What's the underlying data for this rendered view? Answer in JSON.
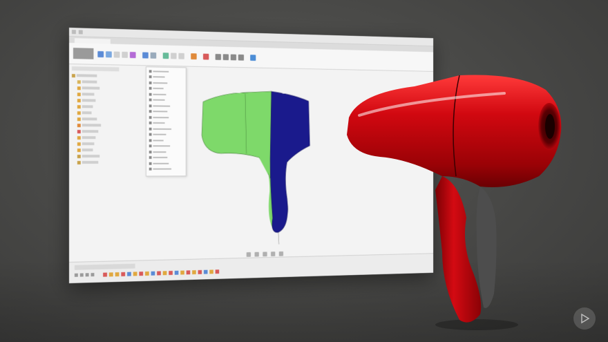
{
  "scene": {
    "description_colors": {
      "background": "#4a4a48",
      "render_red": "#c8020c",
      "render_grip": "#4d4d4d",
      "model_green": "#7ed96a",
      "model_blue": "#1a1a8c"
    }
  },
  "app": {
    "title": "",
    "tab_label": "",
    "workspace_label": "",
    "toolbar_groups": [
      {
        "name": "create",
        "icon_colors": [
          "#5b8bd6",
          "#7aa8e0",
          "#d0d0d0",
          "#d0d0d0",
          "#b46bd6"
        ]
      },
      {
        "name": "modify",
        "icon_colors": [
          "#5b8bd6",
          "#9ab"
        ]
      },
      {
        "name": "assemble",
        "icon_colors": [
          "#6b9",
          "#d0d0d0",
          "#d0d0d0"
        ]
      },
      {
        "name": "construct",
        "icon_colors": [
          "#e08a3a"
        ]
      },
      {
        "name": "inspect",
        "icon_colors": [
          "#d85a5a"
        ]
      },
      {
        "name": "insert",
        "icon_colors": [
          "#8a8a8a",
          "#8a8a8a",
          "#8a8a8a",
          "#8a8a8a"
        ]
      },
      {
        "name": "select",
        "icon_colors": [
          "#4c8dd6"
        ]
      }
    ],
    "browser_rows": [
      {
        "swatch": "#c9a24a",
        "width": 30
      },
      {
        "swatch": "#d9b45a",
        "width": 22
      },
      {
        "swatch": "#e0a840",
        "width": 26
      },
      {
        "swatch": "#e0a840",
        "width": 18
      },
      {
        "swatch": "#e0a840",
        "width": 20
      },
      {
        "swatch": "#e0a840",
        "width": 16
      },
      {
        "swatch": "#e0a840",
        "width": 14
      },
      {
        "swatch": "#e0a840",
        "width": 22
      },
      {
        "swatch": "#e08a3a",
        "width": 28
      },
      {
        "swatch": "#d85a5a",
        "width": 24
      },
      {
        "swatch": "#e0a840",
        "width": 20
      },
      {
        "swatch": "#e0a840",
        "width": 18
      },
      {
        "swatch": "#e0a840",
        "width": 16
      },
      {
        "swatch": "#c9a24a",
        "width": 26
      },
      {
        "swatch": "#c9a24a",
        "width": 24
      }
    ],
    "menu_rows": [
      24,
      18,
      22,
      16,
      20,
      18,
      26,
      22,
      24,
      18,
      28,
      20,
      16,
      26,
      20,
      22,
      24,
      28
    ],
    "timeline_feature_colors": [
      "#d85a5a",
      "#e0a840",
      "#e0a840",
      "#d85a5a",
      "#5b8bd6",
      "#e0a840",
      "#d85a5a",
      "#e0a840",
      "#5b8bd6",
      "#d85a5a",
      "#e0a840",
      "#d85a5a",
      "#5b8bd6",
      "#e0a840",
      "#d85a5a",
      "#e0a840",
      "#d85a5a",
      "#5b8bd6",
      "#e0a840",
      "#d85a5a"
    ]
  },
  "watermark": {
    "icon": "play-logo-icon"
  }
}
